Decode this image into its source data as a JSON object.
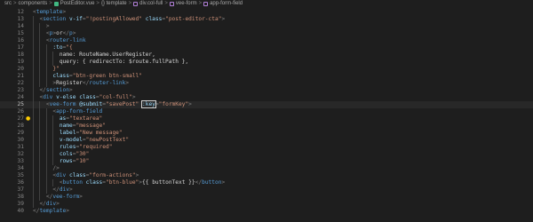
{
  "breadcrumb": {
    "items": [
      "src",
      "components",
      "PostEditor.vue",
      "{} template",
      "div.col-full",
      "vee-form",
      "app-form-field"
    ],
    "separator": ">"
  },
  "editor": {
    "active_line": 25,
    "lines": [
      {
        "num": "12",
        "indent": 0,
        "tokens": [
          [
            "punc",
            "<"
          ],
          [
            "tag",
            "template"
          ],
          [
            "punc",
            ">"
          ]
        ]
      },
      {
        "num": "13",
        "indent": 1,
        "tokens": [
          [
            "punc",
            "<"
          ],
          [
            "tag",
            "section"
          ],
          [
            "text",
            " "
          ],
          [
            "attr",
            "v-if"
          ],
          [
            "punc",
            "="
          ],
          [
            "str",
            "\"!postingAllowed\""
          ],
          [
            "text",
            " "
          ],
          [
            "attr",
            "class"
          ],
          [
            "punc",
            "="
          ],
          [
            "str",
            "\"post-editor-cta\""
          ],
          [
            "punc",
            ">"
          ]
        ]
      },
      {
        "num": "14",
        "indent": 2,
        "tokens": [
          [
            "punc",
            ">"
          ]
        ]
      },
      {
        "num": "15",
        "indent": 2,
        "tokens": [
          [
            "punc",
            "<"
          ],
          [
            "tag",
            "p"
          ],
          [
            "punc",
            ">"
          ],
          [
            "text",
            "or"
          ],
          [
            "punc",
            "</"
          ],
          [
            "tag",
            "p"
          ],
          [
            "punc",
            ">"
          ]
        ]
      },
      {
        "num": "16",
        "indent": 2,
        "tokens": [
          [
            "punc",
            "<"
          ],
          [
            "tag",
            "router-link"
          ]
        ]
      },
      {
        "num": "17",
        "indent": 3,
        "tokens": [
          [
            "attr",
            ":to"
          ],
          [
            "punc",
            "="
          ],
          [
            "str",
            "\"{"
          ]
        ]
      },
      {
        "num": "18",
        "indent": 4,
        "tokens": [
          [
            "text",
            "name: RouteName.UserRegister,"
          ]
        ]
      },
      {
        "num": "19",
        "indent": 4,
        "tokens": [
          [
            "text",
            "query: { redirectTo: $route.fullPath },"
          ]
        ]
      },
      {
        "num": "20",
        "indent": 3,
        "tokens": [
          [
            "str",
            "}\""
          ]
        ]
      },
      {
        "num": "21",
        "indent": 3,
        "tokens": [
          [
            "attr",
            "class"
          ],
          [
            "punc",
            "="
          ],
          [
            "str",
            "\"btn-green btn-small\""
          ]
        ]
      },
      {
        "num": "22",
        "indent": 3,
        "tokens": [
          [
            "punc",
            ">"
          ],
          [
            "text",
            "Register"
          ],
          [
            "punc",
            "</"
          ],
          [
            "tag",
            "router-link"
          ],
          [
            "punc",
            ">"
          ]
        ]
      },
      {
        "num": "23",
        "indent": 1,
        "tokens": [
          [
            "punc",
            "</"
          ],
          [
            "tag",
            "section"
          ],
          [
            "punc",
            ">"
          ]
        ]
      },
      {
        "num": "24",
        "indent": 1,
        "tokens": [
          [
            "punc",
            "<"
          ],
          [
            "tag",
            "div"
          ],
          [
            "text",
            " "
          ],
          [
            "attr",
            "v-else"
          ],
          [
            "text",
            " "
          ],
          [
            "attr",
            "class"
          ],
          [
            "punc",
            "="
          ],
          [
            "str",
            "\"col-full\""
          ],
          [
            "punc",
            ">"
          ]
        ]
      },
      {
        "num": "25",
        "indent": 2,
        "tokens": [
          [
            "punc",
            "<"
          ],
          [
            "tag",
            "vee-form"
          ],
          [
            "text",
            " "
          ],
          [
            "attr",
            "@submit"
          ],
          [
            "punc",
            "="
          ],
          [
            "str",
            "\"savePost\""
          ],
          [
            "text",
            " "
          ],
          [
            "attrsel",
            ":key"
          ],
          [
            "punc",
            "="
          ],
          [
            "str",
            "\"formKey\""
          ],
          [
            "punc",
            ">"
          ]
        ]
      },
      {
        "num": "26",
        "indent": 3,
        "tokens": [
          [
            "punc",
            "<"
          ],
          [
            "tag",
            "app-form-field"
          ]
        ]
      },
      {
        "num": "27",
        "indent": 4,
        "bulb": true,
        "tokens": [
          [
            "attr",
            "as"
          ],
          [
            "punc",
            "="
          ],
          [
            "str",
            "\"textarea\""
          ]
        ]
      },
      {
        "num": "28",
        "indent": 4,
        "tokens": [
          [
            "attr",
            "name"
          ],
          [
            "punc",
            "="
          ],
          [
            "str",
            "\"message\""
          ]
        ]
      },
      {
        "num": "29",
        "indent": 4,
        "tokens": [
          [
            "attr",
            "label"
          ],
          [
            "punc",
            "="
          ],
          [
            "str",
            "\"New message\""
          ]
        ]
      },
      {
        "num": "30",
        "indent": 4,
        "tokens": [
          [
            "attr",
            "v-model"
          ],
          [
            "punc",
            "="
          ],
          [
            "str",
            "\"newPostText\""
          ]
        ]
      },
      {
        "num": "31",
        "indent": 4,
        "tokens": [
          [
            "attr",
            "rules"
          ],
          [
            "punc",
            "="
          ],
          [
            "str",
            "\"required\""
          ]
        ]
      },
      {
        "num": "32",
        "indent": 4,
        "tokens": [
          [
            "attr",
            "cols"
          ],
          [
            "punc",
            "="
          ],
          [
            "str",
            "\"30\""
          ]
        ]
      },
      {
        "num": "33",
        "indent": 4,
        "tokens": [
          [
            "attr",
            "rows"
          ],
          [
            "punc",
            "="
          ],
          [
            "str",
            "\"10\""
          ]
        ]
      },
      {
        "num": "34",
        "indent": 3,
        "tokens": [
          [
            "punc",
            "/>"
          ]
        ]
      },
      {
        "num": "35",
        "indent": 3,
        "tokens": [
          [
            "punc",
            "<"
          ],
          [
            "tag",
            "div"
          ],
          [
            "text",
            " "
          ],
          [
            "attr",
            "class"
          ],
          [
            "punc",
            "="
          ],
          [
            "str",
            "\"form-actions\""
          ],
          [
            "punc",
            ">"
          ]
        ]
      },
      {
        "num": "36",
        "indent": 4,
        "tokens": [
          [
            "punc",
            "<"
          ],
          [
            "tag",
            "button"
          ],
          [
            "text",
            " "
          ],
          [
            "attr",
            "class"
          ],
          [
            "punc",
            "="
          ],
          [
            "str",
            "\"btn-blue\""
          ],
          [
            "punc",
            ">"
          ],
          [
            "text",
            "{{ buttonText }}"
          ],
          [
            "punc",
            "</"
          ],
          [
            "tag",
            "button"
          ],
          [
            "punc",
            ">"
          ]
        ]
      },
      {
        "num": "37",
        "indent": 3,
        "tokens": [
          [
            "punc",
            "</"
          ],
          [
            "tag",
            "div"
          ],
          [
            "punc",
            ">"
          ]
        ]
      },
      {
        "num": "38",
        "indent": 2,
        "tokens": [
          [
            "punc",
            "</"
          ],
          [
            "tag",
            "vee-form"
          ],
          [
            "punc",
            ">"
          ]
        ]
      },
      {
        "num": "39",
        "indent": 1,
        "tokens": [
          [
            "punc",
            "</"
          ],
          [
            "tag",
            "div"
          ],
          [
            "punc",
            ">"
          ]
        ]
      },
      {
        "num": "40",
        "indent": 0,
        "tokens": [
          [
            "punc",
            "</"
          ],
          [
            "tag",
            "template"
          ],
          [
            "punc",
            ">"
          ]
        ]
      }
    ]
  },
  "icons": {
    "lightbulb": "lightbulb-icon",
    "vue_file": "vue-file-icon",
    "braces": "braces-icon",
    "element": "element-box-icon"
  }
}
